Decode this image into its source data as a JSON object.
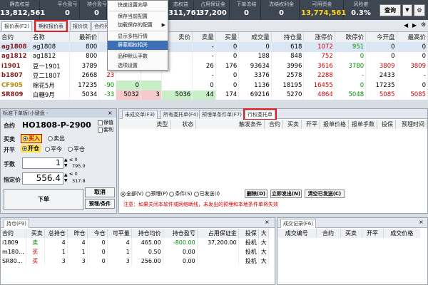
{
  "topbar": {
    "stats": [
      {
        "label": "静态权益",
        "value": "13,812,561"
      },
      {
        "label": "平仓盈亏",
        "value": "0"
      },
      {
        "label": "持仓盈亏",
        "value": "0"
      },
      {
        "label": "态权益",
        "value": "311,761"
      },
      {
        "label": "占用保证金",
        "value": "37,200"
      },
      {
        "label": "下单冻结",
        "value": "0"
      },
      {
        "label": "冻结权利金",
        "value": "0"
      },
      {
        "label": "可用资金",
        "value": "13,774,561"
      },
      {
        "label": "风险度",
        "value": "0.3%"
      }
    ],
    "query_button": "查询",
    "dropdown_arrow": "▼"
  },
  "quote_tabs": [
    "报价表(F2)",
    "期权报价表",
    "报价快",
    "合约列"
  ],
  "menu": {
    "items": [
      {
        "label": "快速设置向导",
        "arrow": ""
      },
      {
        "label": "保存当前配置",
        "arrow": ""
      },
      {
        "label": "加载保存的配置",
        "arrow": "▶"
      },
      {
        "label": "显示多档行情",
        "arrow": ""
      },
      {
        "label": "屏蔽期权相关",
        "arrow": ""
      },
      {
        "label": "品种默认手数",
        "arrow": ""
      },
      {
        "label": "选项设置",
        "arrow": ""
      }
    ]
  },
  "quote_table": {
    "headers": [
      "合约",
      "名称",
      "最新价",
      "涨",
      "",
      "",
      "卖价",
      "卖量",
      "买量",
      "成交量",
      "持仓量",
      "涨停价",
      "跌停价",
      "今开盘",
      "最高价"
    ],
    "rows": [
      {
        "code": "ag1808",
        "name": "ag1808",
        "last": "800",
        "chg": "",
        "c5": "",
        "c6": "",
        "ask": "",
        "askv": "-",
        "bidv": "0",
        "vol": "0",
        "oi": "618",
        "up": "1072",
        "down": "951",
        "open": "0",
        "high": "0"
      },
      {
        "code": "ag1812",
        "name": "ag1812",
        "last": "800",
        "chg": "",
        "c5": "",
        "c6": "",
        "ask": "",
        "askv": "-",
        "bidv": "0",
        "vol": "188",
        "oi": "848",
        "up": "752",
        "down": "0",
        "open": "0",
        "high": "0"
      },
      {
        "code": "i1901",
        "name": "豆一1901",
        "last": "3789",
        "chg": "",
        "c5": "",
        "c6": "3789",
        "ask": "",
        "askv": "26",
        "bidv": "176",
        "vol": "93634",
        "oi": "3996",
        "up": "3616",
        "down": "3780",
        "open": "3809",
        "high": "3809"
      },
      {
        "code": "b1807",
        "name": "豆二1807",
        "last": "2668",
        "chg": "23",
        "c5": "",
        "c6": "",
        "ask": "",
        "askv": "-",
        "bidv": "0",
        "vol": "3376",
        "oi": "2578",
        "up": "2288",
        "down": "-",
        "open": "2433",
        "high": "-"
      },
      {
        "code": "CF905",
        "name": "棉花5月",
        "last": "17235",
        "chg": "-90",
        "c5": "0",
        "c6": "",
        "ask": "",
        "askv": "0",
        "bidv": "0",
        "vol": "1136",
        "oi": "18195",
        "up": "16455",
        "down": "0",
        "open": "17235",
        "high": "0"
      },
      {
        "code": "SR809",
        "name": "白糖9月",
        "last": "5034",
        "chg": "-33",
        "c5": "5032",
        "c6": "3",
        "ask": "5036",
        "askv": "44",
        "bidv": "174",
        "vol": "69216",
        "oi": "5270",
        "up": "4864",
        "down": "5048",
        "open": "5085",
        "high": "5085"
      }
    ]
  },
  "order_panel": {
    "title": "标准下单板(小键盘 -",
    "contract_label": "合约",
    "contract_value": "HO1808-P-2900",
    "hedge_label": "保值",
    "hedge_checked": false,
    "arb_label": "套利",
    "buysell_label": "买卖",
    "buy": "买入",
    "sell": "卖出",
    "openclose_label": "开平",
    "open": "开仓",
    "close": "平今",
    "close2": "平仓",
    "qty_label": "手数",
    "qty": "1",
    "qty_hint1": "≤ 0",
    "qty_hint2": "795.0",
    "price_label": "指定价",
    "price": "556.4",
    "price_hint1": "≤ 0",
    "price_hint2": "317.8",
    "order_btn": "下单",
    "cancel_btn": "取消",
    "preorder_btn": "预埋/条件"
  },
  "right_panel": {
    "tabs": [
      "未成交单(F3)",
      "所有委托单(F4)",
      "预埋单条件单(F7)",
      "行权委托单"
    ],
    "headers": [
      "类型",
      "状态",
      "触发条件",
      "合约",
      "买卖",
      "开平",
      "报单价格",
      "报单手数",
      "投保",
      "预埋时间"
    ],
    "filters": [
      "全部(V)",
      "预埋(P)",
      "条件(S)",
      "已发送(I)"
    ],
    "buttons": [
      "删除(D)",
      "立即发出(N)",
      "清空已发送(C)"
    ],
    "warning": "注意：如果关闭本软件或网络断线，未发出的预埋和本地条件单将失效"
  },
  "positions": {
    "tab": "持仓(F9)",
    "headers": [
      "合约",
      "买卖",
      "总持仓",
      "昨仓",
      "今仓",
      "可平量",
      "持仓均价",
      "持仓盈亏",
      "占用保证金",
      "投保",
      "大"
    ],
    "rows": [
      {
        "code": "i1809",
        "side": "卖",
        "total": "4",
        "yd": "4",
        "td": "0",
        "avail": "4",
        "avg": "465.00",
        "pnl": "-800.00",
        "margin": "37,200.00",
        "hedge": "投机",
        "x": "大"
      },
      {
        "code": "m180...",
        "side": "买",
        "total": "1",
        "yd": "1",
        "td": "0",
        "avail": "1",
        "avg": "0.50",
        "pnl": "0.00",
        "margin": "",
        "hedge": "投机",
        "x": "大"
      },
      {
        "code": "SR80...",
        "side": "买",
        "total": "3",
        "yd": "3",
        "td": "0",
        "avail": "3",
        "avg": "256.00",
        "pnl": "0.00",
        "margin": "",
        "hedge": "投机",
        "x": "大"
      }
    ]
  },
  "deals": {
    "tab": "成交记录(F6)",
    "headers": [
      "成交编号",
      "合约",
      "买卖",
      "开平",
      "成交价格"
    ]
  }
}
